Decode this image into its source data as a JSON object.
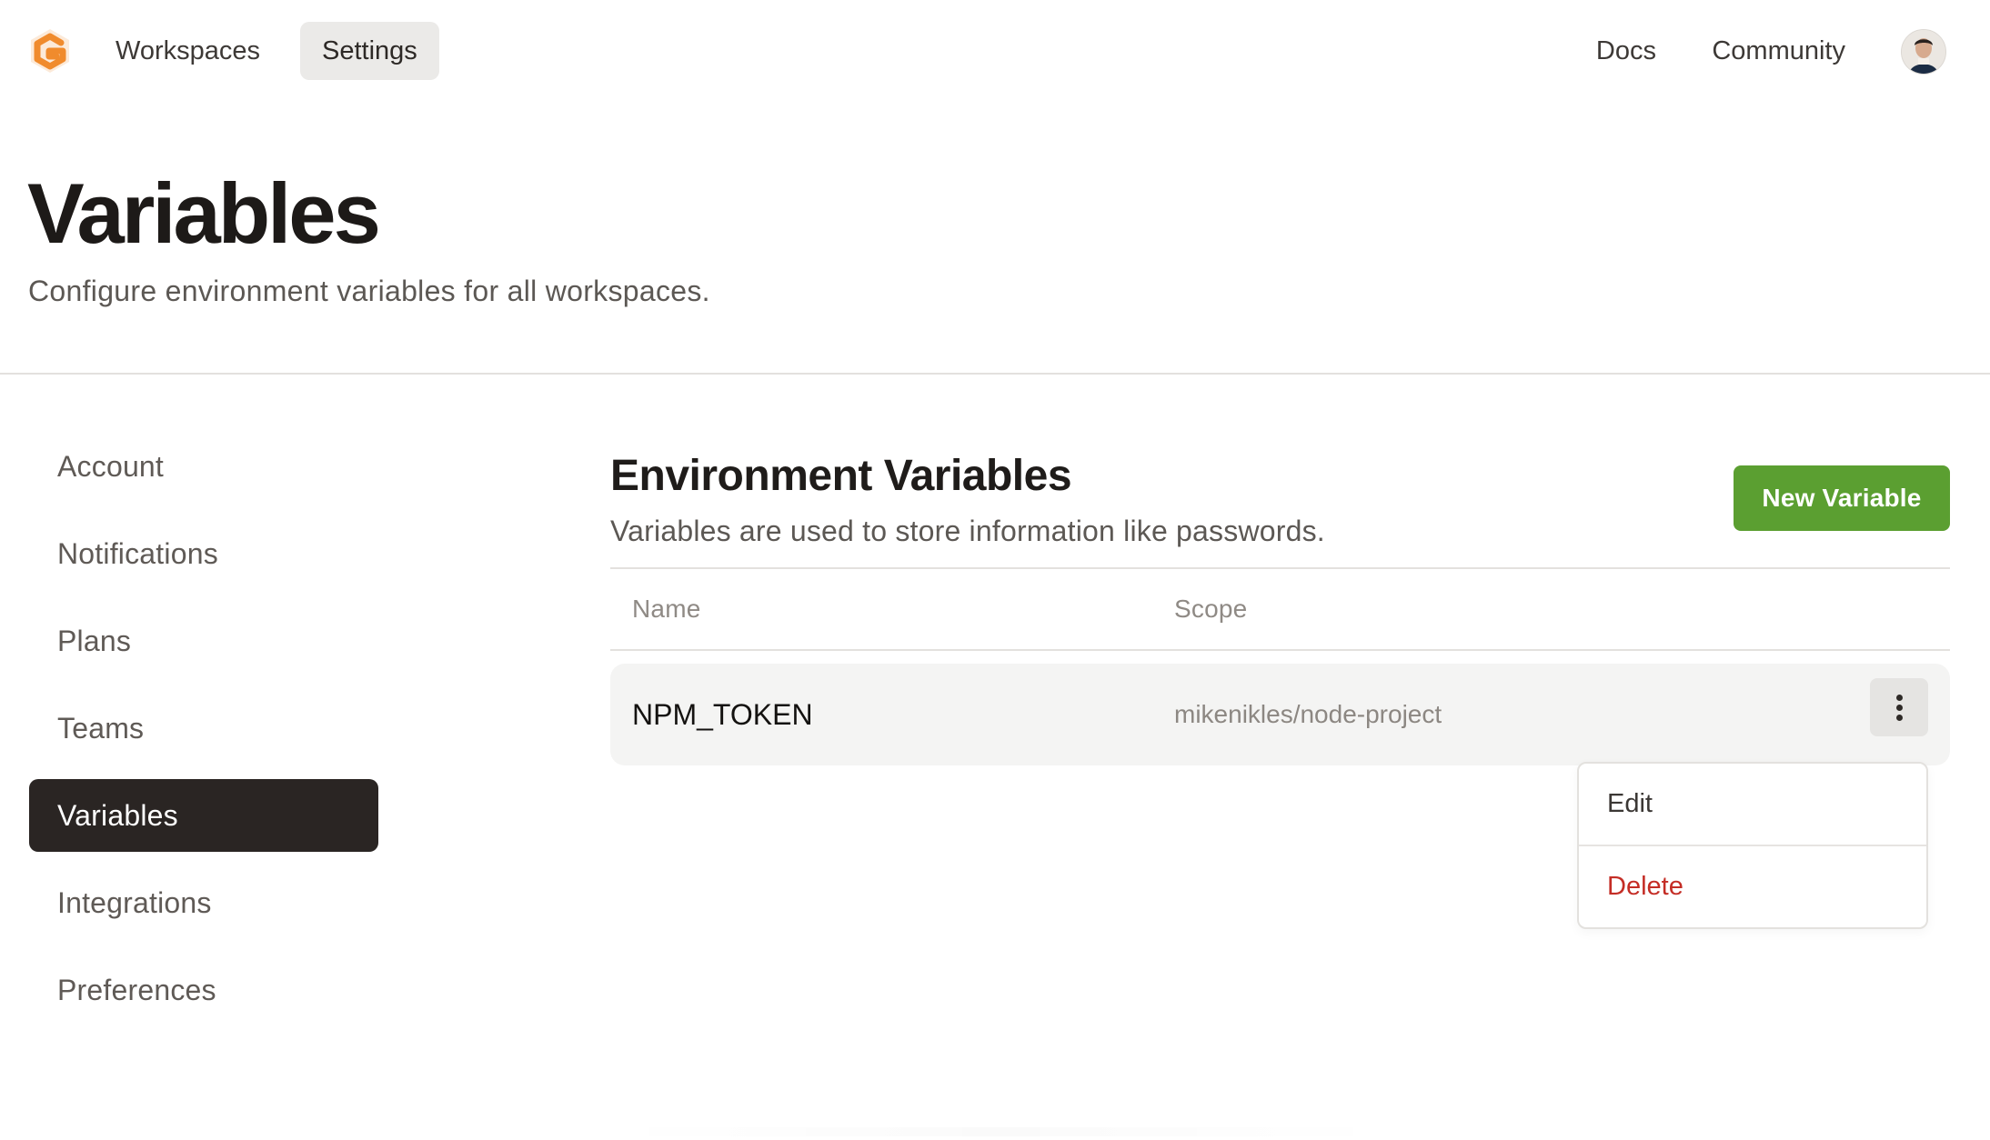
{
  "nav": {
    "logo_icon": "app-logo-icon",
    "links": {
      "workspaces": "Workspaces",
      "settings": "Settings",
      "docs": "Docs",
      "community": "Community"
    },
    "avatar_icon": "user-avatar-icon",
    "active": "Settings"
  },
  "header": {
    "title": "Variables",
    "subtitle": "Configure environment variables for all workspaces."
  },
  "sidebar": {
    "items": [
      {
        "label": "Account"
      },
      {
        "label": "Notifications"
      },
      {
        "label": "Plans"
      },
      {
        "label": "Teams"
      },
      {
        "label": "Variables"
      },
      {
        "label": "Integrations"
      },
      {
        "label": "Preferences"
      }
    ],
    "active": "Variables"
  },
  "main": {
    "title": "Environment Variables",
    "description": "Variables are used to store information like passwords.",
    "new_button": "New Variable",
    "table": {
      "columns": [
        "Name",
        "Scope"
      ],
      "rows": [
        {
          "name": "NPM_TOKEN",
          "scope": "mikenikles/node-project"
        }
      ]
    },
    "row_menu": {
      "icon": "more-vertical-icon",
      "items": [
        {
          "label": "Edit"
        },
        {
          "label": "Delete"
        }
      ]
    }
  },
  "colors": {
    "accent_green": "#5b9f31",
    "active_sidebar": "#2a2523",
    "danger": "#c42d25",
    "logo_orange": "#f08b2d"
  }
}
